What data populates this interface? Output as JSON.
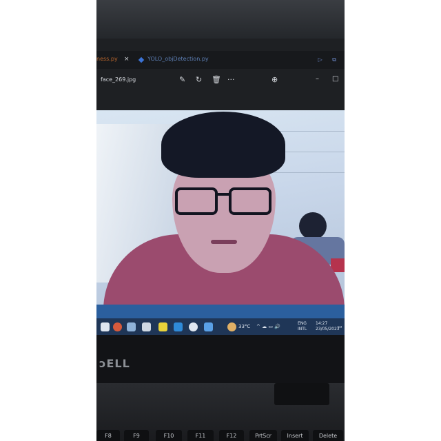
{
  "editor": {
    "tab_active_suffix": "ness.py",
    "tab_close": "×",
    "tab_second": "YOLO_objDetection.py"
  },
  "viewer": {
    "file_name": "face_269.jpg",
    "tools": [
      "edit-icon",
      "rotate-icon",
      "delete-icon",
      "more-icon",
      "zoom-in-icon"
    ],
    "more_label": "···"
  },
  "taskbar": {
    "weather": "33°C",
    "lang_top": "ENG",
    "lang_bottom": "INTL",
    "time": "14:27",
    "date": "23/05/2023"
  },
  "laptop": {
    "brand": "DELL",
    "keys": [
      "F8",
      "F9",
      "F10",
      "F11",
      "F12",
      "PrtScr",
      "Insert",
      "Delete"
    ]
  },
  "colors": {
    "screen_dark": "#1e2023",
    "taskbar": "#1f3657",
    "shirt": "#9b4b6e"
  }
}
